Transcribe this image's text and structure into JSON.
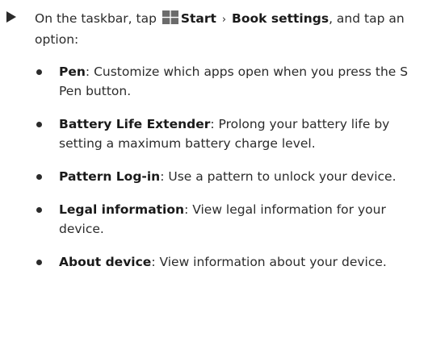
{
  "instruction": {
    "prefix": "On the taskbar, tap",
    "start_label": "Start",
    "separator": "›",
    "book_settings_label": "Book settings",
    "suffix": ", and tap an option:"
  },
  "icons": {
    "step_marker": "triangle-arrow-icon",
    "start": "windows-start-icon",
    "bullet": "bullet-dot-icon"
  },
  "options": [
    {
      "title": "Pen",
      "description": ": Customize which apps open when you press the S Pen button."
    },
    {
      "title": "Battery Life Extender",
      "description": ": Prolong your battery life by setting a maximum battery charge level."
    },
    {
      "title": "Pattern Log-in",
      "description": ": Use a pattern to unlock your device."
    },
    {
      "title": "Legal information",
      "description": ": View legal information for your device."
    },
    {
      "title": "About device",
      "description": ": View information about your device."
    }
  ],
  "colors": {
    "text": "#2b2b2b",
    "windows_icon": "#6b6b6b"
  }
}
